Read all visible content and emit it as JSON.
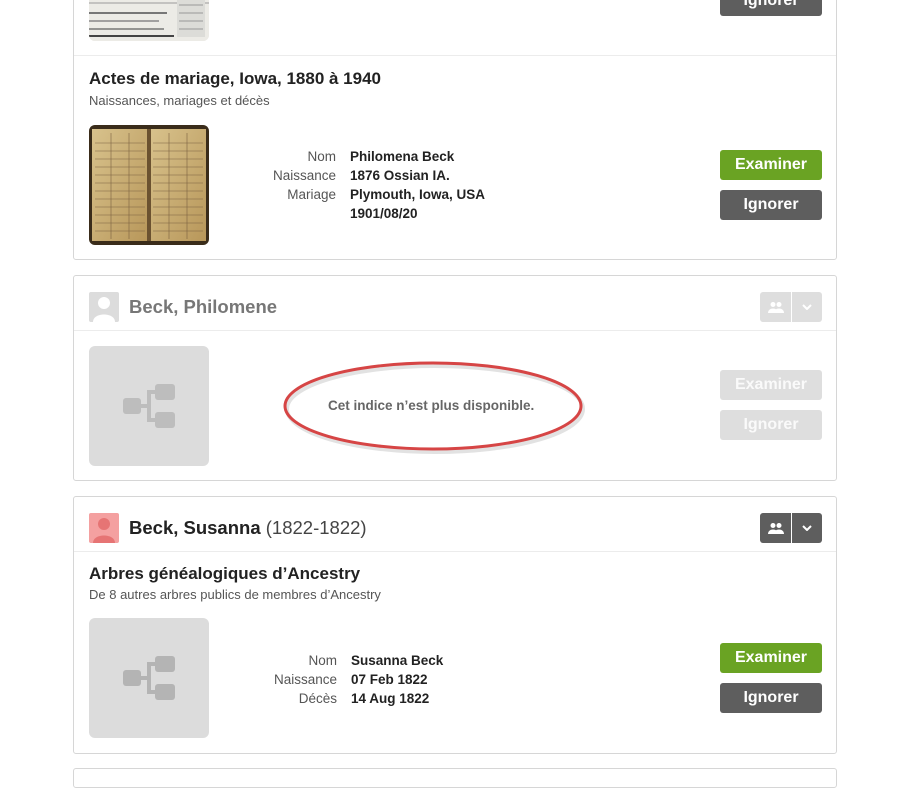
{
  "top_card": {
    "ignore_label": "Ignorer"
  },
  "hint1": {
    "title": "Actes de mariage, Iowa, 1880 à 1940",
    "subtitle": "Naissances, mariages et décès",
    "fields": [
      {
        "label": "Nom",
        "value": "Philomena Beck"
      },
      {
        "label": "Naissance",
        "value": "1876 Ossian IA."
      },
      {
        "label": "Mariage",
        "value": "Plymouth, Iowa, USA"
      },
      {
        "label": "",
        "value": "1901/08/20"
      }
    ],
    "review_label": "Examiner",
    "ignore_label": "Ignorer"
  },
  "person2": {
    "name": "Beck, Philomene",
    "message": "Cet indice n’est plus disponible.",
    "review_label": "Examiner",
    "ignore_label": "Ignorer",
    "icons": {
      "people": "people-icon",
      "dropdown": "chevron-down-icon",
      "tree": "tree-icon"
    }
  },
  "person3": {
    "name": "Beck, Susanna",
    "years": "(1822-1822)",
    "hint_title": "Arbres généalogiques d’Ancestry",
    "hint_subtitle": "De 8 autres arbres publics de membres d’Ancestry",
    "fields": [
      {
        "label": "Nom",
        "value": "Susanna Beck"
      },
      {
        "label": "Naissance",
        "value": "07 Feb 1822"
      },
      {
        "label": "Décès",
        "value": "14 Aug 1822"
      }
    ],
    "review_label": "Examiner",
    "ignore_label": "Ignorer"
  },
  "colors": {
    "green": "#6aa323",
    "dark_gray": "#5e5e5e",
    "disabled": "#dedede",
    "annotation_red": "#d64545"
  }
}
